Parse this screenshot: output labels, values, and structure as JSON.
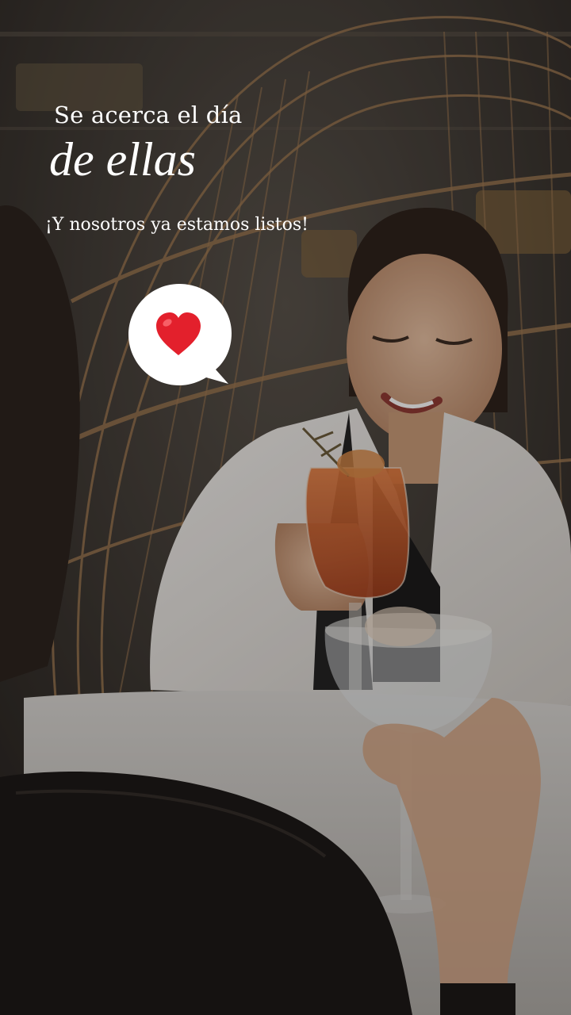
{
  "story": {
    "headline_line1": "Se acerca el día",
    "headline_line2": "de ellas",
    "subline": "¡Y nosotros ya estamos listos!"
  },
  "sticker": {
    "icon": "heart-icon",
    "heart_color": "#e3202c",
    "bubble_color": "#ffffff"
  },
  "colors": {
    "text": "#ffffff",
    "overlay": "#1d1b19"
  }
}
